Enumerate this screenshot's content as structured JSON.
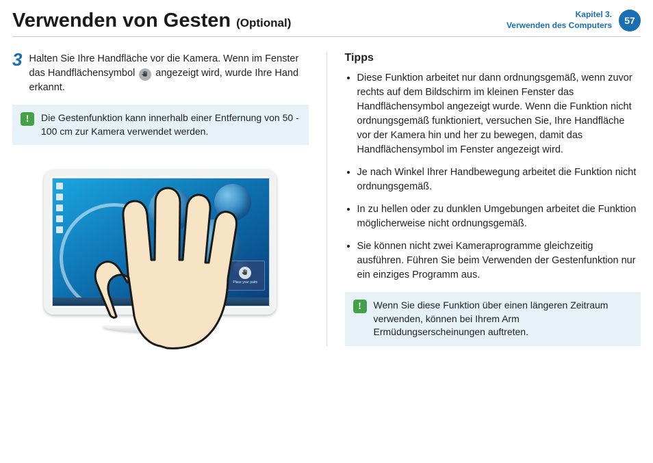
{
  "header": {
    "title": "Verwenden von Gesten",
    "optional": "(Optional)",
    "chapter_line1": "Kapitel 3.",
    "chapter_line2": "Verwenden des Computers",
    "page": "57"
  },
  "left": {
    "step_number": "3",
    "step_text_a": "Halten Sie Ihre Handfläche vor die Kamera. Wenn im Fenster das Handflächensymbol ",
    "step_text_b": " angezeigt wird, wurde Ihre Hand erkannt.",
    "note": "Die Gestenfunktion kann innerhalb einer Entfernung von 50 - 100 cm zur Kamera verwendet werden.",
    "palm_box_label": "Place your palm"
  },
  "right": {
    "tips_title": "Tipps",
    "tips": [
      "Diese Funktion arbeitet nur dann ordnungsgemäß, wenn zuvor rechts auf dem Bildschirm im kleinen Fenster das Handflächensymbol angezeigt wurde. Wenn die Funktion nicht ordnungsgemäß funktioniert, versuchen Sie, Ihre Handfläche vor der Kamera hin und her zu bewegen, damit das Handflächensymbol im Fenster angezeigt wird.",
      "Je nach Winkel Ihrer Handbewegung arbeitet die Funktion nicht ordnungsgemäß.",
      "In zu hellen oder zu dunklen Umgebungen arbeitet die Funktion möglicherweise nicht ordnungsgemäß.",
      "Sie können nicht zwei Kameraprogramme gleichzeitig ausführen. Führen Sie beim Verwenden der Gestenfunktion nur ein einziges Programm aus."
    ],
    "note": "Wenn Sie diese Funktion über einen längeren Zeitraum verwenden, können bei Ihrem Arm Ermüdungserscheinungen auftreten."
  }
}
